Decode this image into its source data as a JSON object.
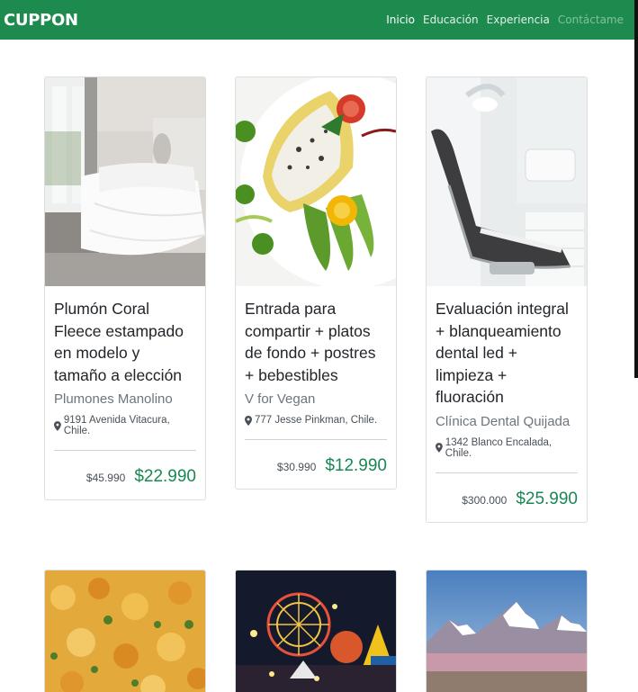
{
  "navbar": {
    "brand": "CUPPON",
    "links": [
      {
        "label": "Inicio"
      },
      {
        "label": "Educación"
      },
      {
        "label": "Experiencia"
      },
      {
        "label": "Contáctame"
      }
    ]
  },
  "cards": [
    {
      "image": "bedroom-comforter-photo",
      "title": "Plumón Coral Fleece estampado en modelo y tamaño a elección",
      "merchant": "Plumones Manolino",
      "address": "9191 Avenida Vitacura, Chile.",
      "old_price": "$45.990",
      "new_price": "$22.990"
    },
    {
      "image": "vegan-dish-photo",
      "title": "Entrada para compartir + platos de fondo + postres + bebestibles",
      "merchant": "V for Vegan",
      "address": "777 Jesse Pinkman, Chile.",
      "old_price": "$30.990",
      "new_price": "$12.990"
    },
    {
      "image": "dental-chair-photo",
      "title": "Evaluación integral + blanqueamiento dental led + limpieza + fluoración",
      "merchant": "Clínica Dental Quijada",
      "address": "1342 Blanco Encalada, Chile.",
      "old_price": "$300.000",
      "new_price": "$25.990"
    },
    {
      "image": "food-rice-dish-photo"
    },
    {
      "image": "night-fair-ferris-wheel-photo"
    },
    {
      "image": "snowy-volcano-landscape-photo"
    }
  ],
  "colors": {
    "navbar_bg": "#1d8a4e",
    "price_green": "#198754"
  }
}
